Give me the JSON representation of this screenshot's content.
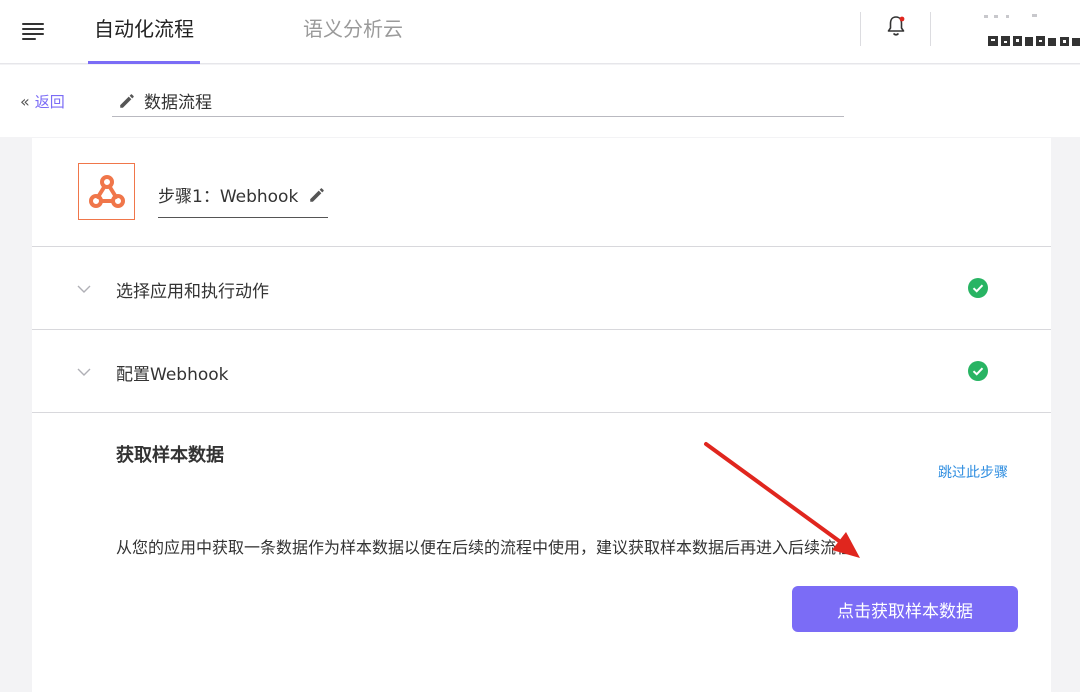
{
  "nav": {
    "tabs": [
      {
        "label": "自动化流程",
        "active": true
      },
      {
        "label": "语义分析云",
        "active": false
      }
    ],
    "accent": "#7b6cf6"
  },
  "subheader": {
    "back_label": "返回",
    "flow_name": "数据流程"
  },
  "step": {
    "title": "步骤1：Webhook",
    "brand_color": "#f0764a"
  },
  "sections": [
    {
      "label": "选择应用和执行动作",
      "status": "complete"
    },
    {
      "label": "配置Webhook",
      "status": "complete"
    }
  ],
  "sample": {
    "title": "获取样本数据",
    "skip_label": "跳过此步骤",
    "description": "从您的应用中获取一条数据作为样本数据以便在后续的流程中使用，建议获取样本数据后再进入后续流程",
    "button_label": "点击获取样本数据"
  },
  "colors": {
    "success": "#28b463",
    "link": "#2f8ee0",
    "annotation_arrow": "#e0261e"
  }
}
